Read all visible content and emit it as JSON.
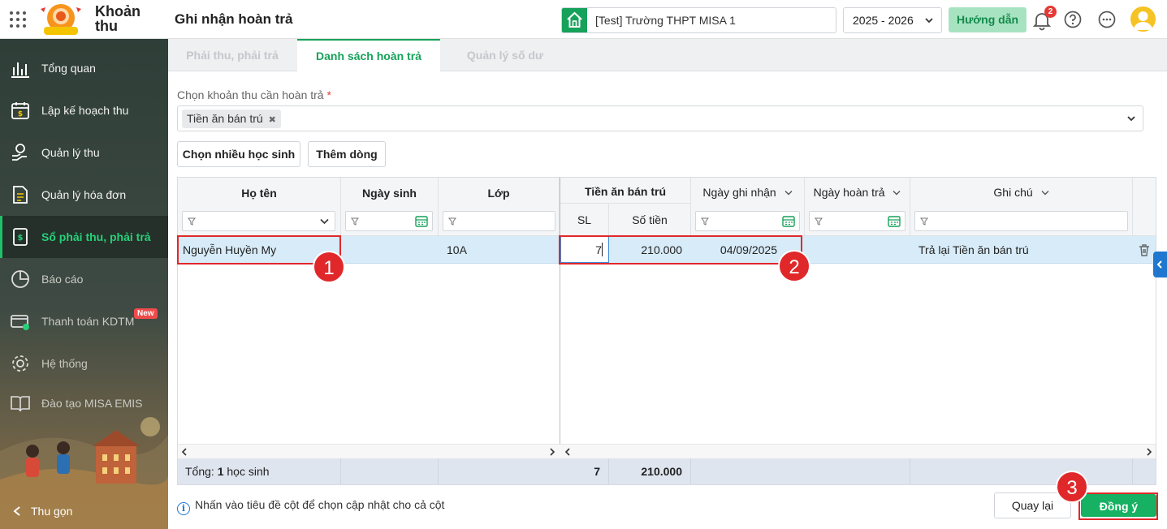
{
  "header": {
    "app_name_line1": "Khoản",
    "app_name_line2": "thu",
    "page_title": "Ghi nhận hoàn trả",
    "school": "[Test] Trường THPT MISA 1",
    "year": "2025 - 2026",
    "guide_label": "Hướng dẫn",
    "notification_count": "2",
    "accent_color": "#16a25a"
  },
  "sidebar": {
    "items": [
      {
        "label": "Tổng quan",
        "icon": "bar-chart-icon"
      },
      {
        "label": "Lập kế hoạch thu",
        "icon": "calendar-money-icon"
      },
      {
        "label": "Quản lý thu",
        "icon": "hand-coin-icon"
      },
      {
        "label": "Quản lý hóa đơn",
        "icon": "invoice-icon"
      },
      {
        "label": "Sổ phải thu, phải trả",
        "icon": "ledger-icon"
      },
      {
        "label": "Báo cáo",
        "icon": "pie-chart-icon"
      },
      {
        "label": "Thanh toán KDTM",
        "icon": "payment-icon"
      },
      {
        "label": "Hệ thống",
        "icon": "gear-icon"
      },
      {
        "label": "Đào tạo MISA EMIS",
        "icon": "book-icon"
      }
    ],
    "new_badge": "New",
    "collapse_label": "Thu gọn"
  },
  "tabs": [
    {
      "label": "Phải thu, phải trả"
    },
    {
      "label": "Danh sách hoàn trả"
    },
    {
      "label": "Quản lý số dư"
    }
  ],
  "form": {
    "select_label": "Chọn khoản thu cần hoàn trả",
    "required_mark": "*",
    "selected_chip": "Tiền ăn bán trú",
    "btn_choose_students": "Chọn nhiều học sinh",
    "btn_add_row": "Thêm dòng"
  },
  "grid": {
    "headers": {
      "name": "Họ tên",
      "dob": "Ngày sinh",
      "class": "Lớp",
      "group": "Tiền ăn bán trú",
      "qty": "SL",
      "amount": "Số tiền",
      "record_date": "Ngày ghi nhận",
      "refund_date": "Ngày hoàn trả",
      "note": "Ghi chú"
    },
    "rows": [
      {
        "name": "Nguyễn Huyền My",
        "dob": "",
        "class": "10A",
        "qty": "7",
        "amount": "210.000",
        "record_date": "04/09/2025",
        "refund_date": "",
        "note": "Trả lại Tiền ăn bán trú"
      }
    ],
    "footer": {
      "total_prefix": "Tổng: ",
      "total_count": "1",
      "total_suffix": " học sinh",
      "qty": "7",
      "amount": "210.000"
    }
  },
  "hint": "Nhấn vào tiêu đề cột để chọn cập nhật cho cả cột",
  "hint_icon_glyph": "i",
  "actions": {
    "back": "Quay lại",
    "confirm": "Đồng ý"
  },
  "markers": [
    "1",
    "2",
    "3"
  ]
}
